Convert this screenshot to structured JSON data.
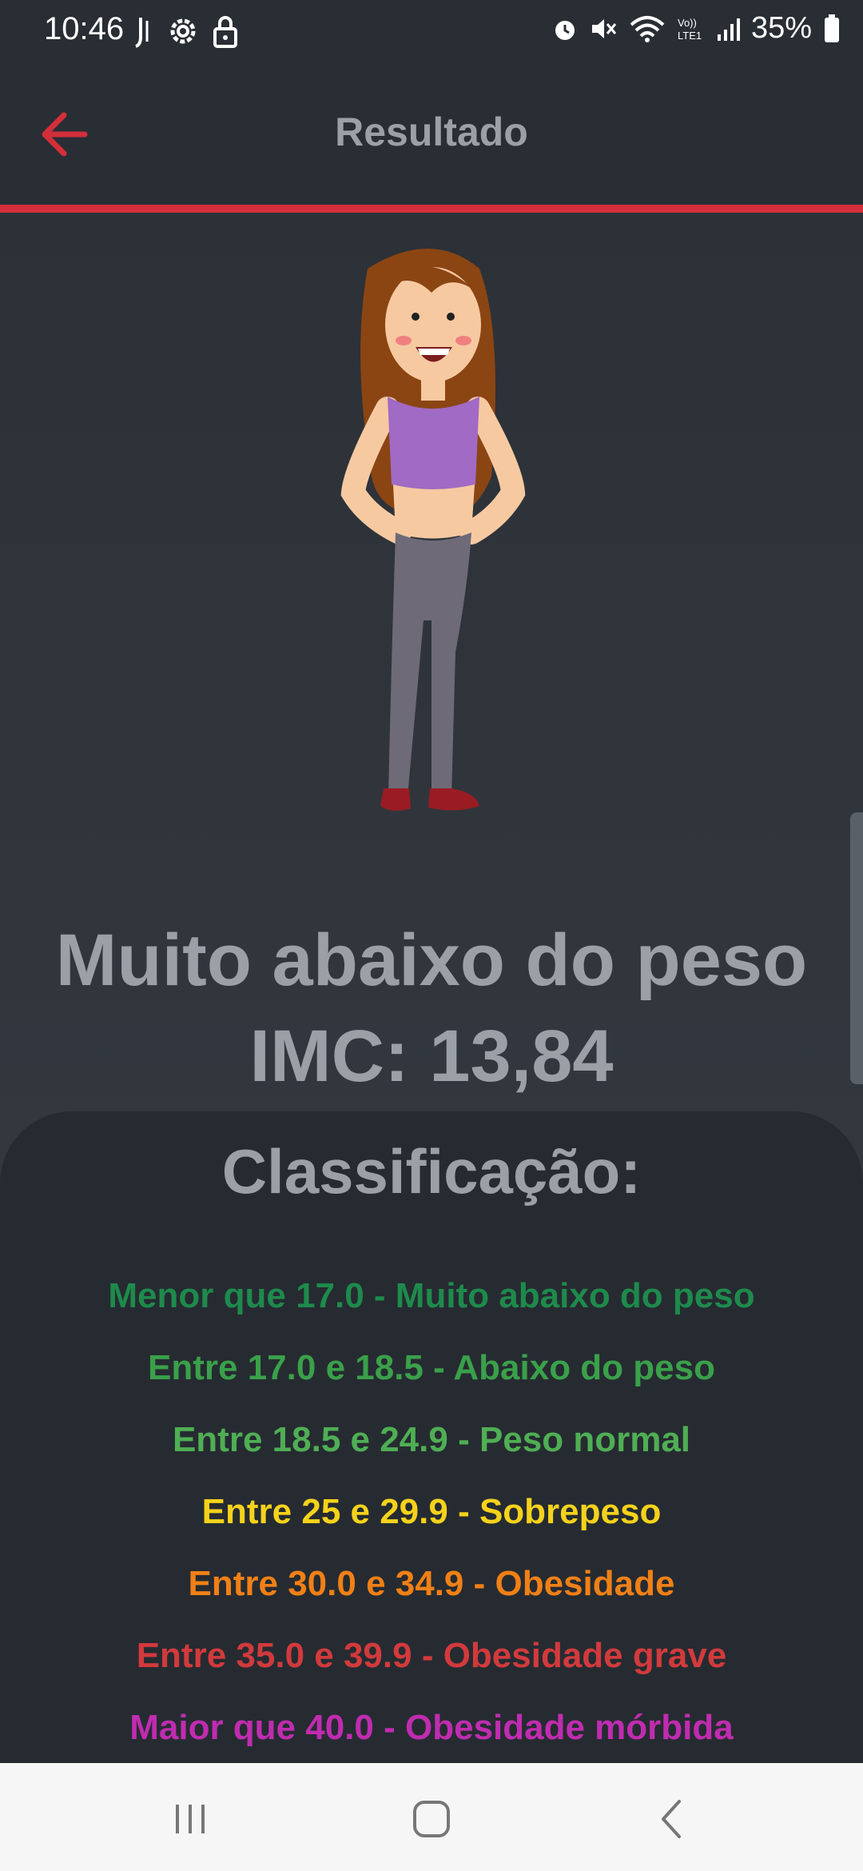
{
  "statusbar": {
    "time": "10:46",
    "battery": "35%",
    "left_icons": [
      "signal-app-icon",
      "settings-icon",
      "lock-icon"
    ],
    "right_icons": [
      "alarm-icon",
      "mute-icon",
      "wifi-icon",
      "volte-icon",
      "cell-signal-icon",
      "battery-icon"
    ]
  },
  "appbar": {
    "title": "Resultado",
    "back_icon": "arrow-left-icon",
    "accent": "#d32f3a"
  },
  "result": {
    "status": "Muito abaixo do peso",
    "imc_label": "IMC: 13,84"
  },
  "classification": {
    "title": "Classificação:",
    "items": [
      {
        "text": "Menor que 17.0 - Muito abaixo do peso",
        "color": "#1e8a4c"
      },
      {
        "text": "Entre 17.0 e 18.5 - Abaixo do peso",
        "color": "#3aa04a"
      },
      {
        "text": "Entre 18.5 e 24.9 - Peso normal",
        "color": "#4fae54"
      },
      {
        "text": "Entre 25 e 29.9 - Sobrepeso",
        "color": "#f5d21b"
      },
      {
        "text": "Entre 30.0 e 34.9 - Obesidade",
        "color": "#f08016"
      },
      {
        "text": "Entre 35.0 e 39.9 - Obesidade grave",
        "color": "#d23a3c"
      },
      {
        "text": "Maior que 40.0 - Obesidade mórbida",
        "color": "#c02cb0"
      }
    ]
  },
  "navbar": {
    "buttons": [
      "recents-icon",
      "home-icon",
      "back-icon"
    ]
  }
}
